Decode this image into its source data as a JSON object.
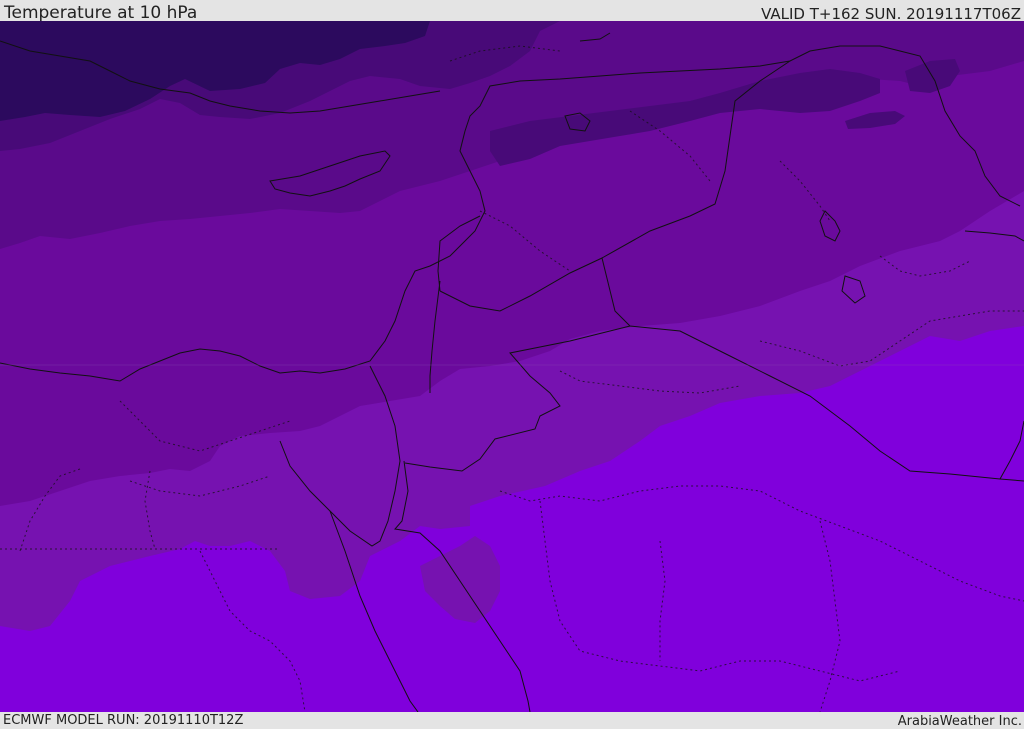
{
  "header": {
    "title": "Temperature at 10 hPa",
    "valid": "VALID T+162 SUN. 20191117T06Z"
  },
  "footer": {
    "model_run": "ECMWF MODEL RUN: 20191110T12Z",
    "credit": "ArabiaWeather Inc."
  },
  "map": {
    "field": "temperature",
    "level": "10 hPa",
    "colors": {
      "band_coldest": "#2c0a5e",
      "band_1": "#480a78",
      "band_2": "#5a0a8a",
      "band_3": "#6a0a9c",
      "band_4": "#7612b0",
      "band_warmest": "#8000dc",
      "border": "#111111"
    }
  }
}
